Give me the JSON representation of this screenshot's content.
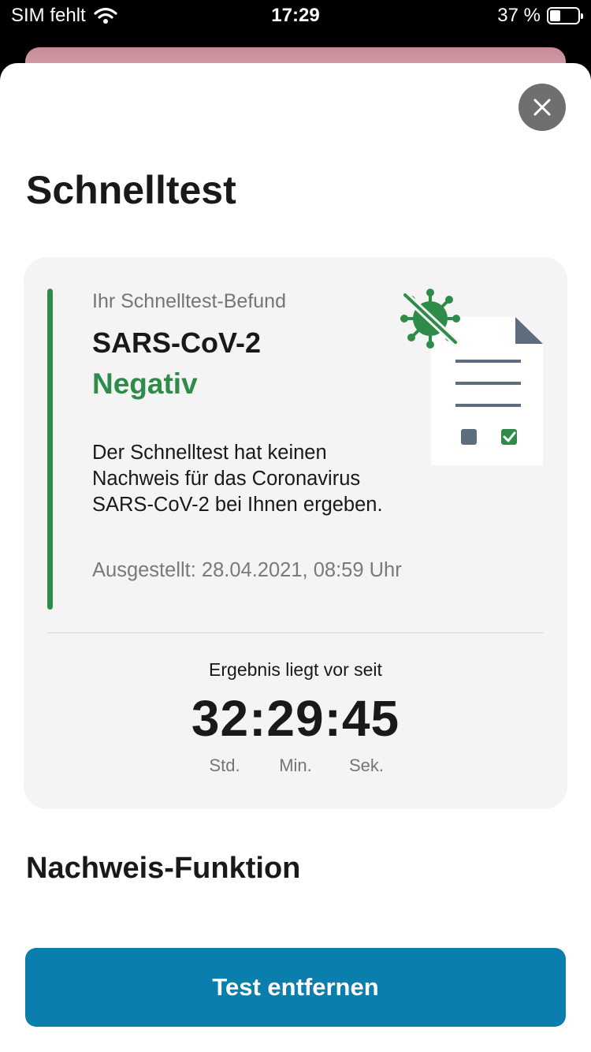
{
  "status_bar": {
    "carrier": "SIM fehlt",
    "time": "17:29",
    "battery_text": "37 %",
    "battery_level": 0.37
  },
  "page": {
    "title": "Schnelltest",
    "close_icon": "close-icon"
  },
  "result_card": {
    "label": "Ihr Schnelltest-Befund",
    "virus": "SARS-CoV-2",
    "status": "Negativ",
    "description": "Der Schnelltest hat keinen Nachweis für das Coronavirus SARS-CoV-2 bei Ihnen ergeben.",
    "issued": "Ausgestellt: 28.04.2021, 08:59 Uhr",
    "status_color": "#2e8b4a",
    "timer": {
      "label": "Ergebnis liegt vor seit",
      "value": "32:29:45",
      "units": [
        "Std.",
        "Min.",
        "Sek."
      ]
    }
  },
  "section": {
    "title": "Nachweis-Funktion"
  },
  "actions": {
    "remove_label": "Test entfernen",
    "accent": "#0a7ead"
  }
}
